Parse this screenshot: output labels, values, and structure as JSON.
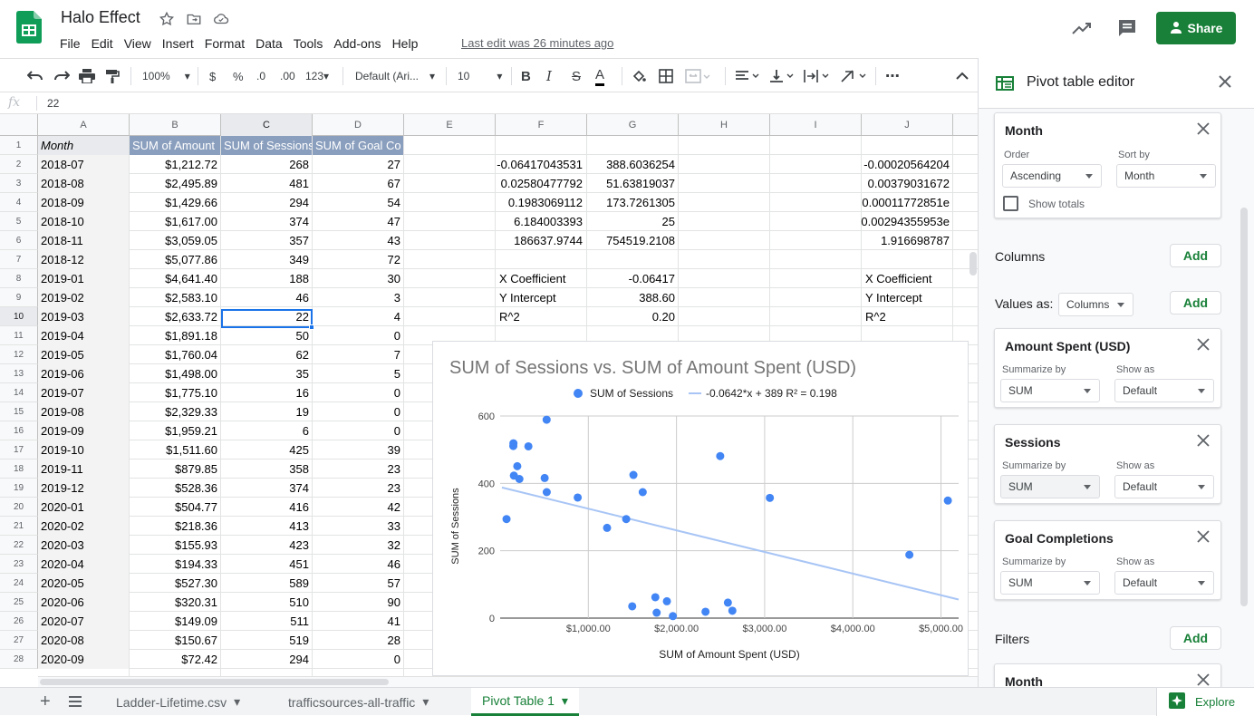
{
  "app": {
    "doc_title": "Halo Effect",
    "menu": [
      "File",
      "Edit",
      "View",
      "Insert",
      "Format",
      "Data",
      "Tools",
      "Add-ons",
      "Help"
    ],
    "last_edit": "Last edit was 26 minutes ago",
    "share_label": "Share",
    "brand_color": "#188038"
  },
  "toolbar": {
    "zoom": "100%",
    "currency": "$",
    "percent": "%",
    "dec_less": ".0",
    "dec_more": ".00",
    "format_more": "123",
    "font": "Default (Ari...",
    "font_size": "10",
    "bold": "B",
    "italic": "I",
    "strike": "S",
    "text_color": "A"
  },
  "formula_bar": {
    "fx": "fx",
    "value": "22"
  },
  "columns": [
    "A",
    "B",
    "C",
    "D",
    "E",
    "F",
    "G",
    "H",
    "I",
    "J"
  ],
  "selected_column": "C",
  "selected_row": 10,
  "header_row": [
    "Month",
    "SUM of Amount",
    "SUM of Sessions",
    "SUM of Goal Co"
  ],
  "rows": [
    [
      "2018-07",
      "$1,212.72",
      "268",
      "27"
    ],
    [
      "2018-08",
      "$2,495.89",
      "481",
      "67"
    ],
    [
      "2018-09",
      "$1,429.66",
      "294",
      "54"
    ],
    [
      "2018-10",
      "$1,617.00",
      "374",
      "47"
    ],
    [
      "2018-11",
      "$3,059.05",
      "357",
      "43"
    ],
    [
      "2018-12",
      "$5,077.86",
      "349",
      "72"
    ],
    [
      "2019-01",
      "$4,641.40",
      "188",
      "30"
    ],
    [
      "2019-02",
      "$2,583.10",
      "46",
      "3"
    ],
    [
      "2019-03",
      "$2,633.72",
      "22",
      "4"
    ],
    [
      "2019-04",
      "$1,891.18",
      "50",
      "0"
    ],
    [
      "2019-05",
      "$1,760.04",
      "62",
      "7"
    ],
    [
      "2019-06",
      "$1,498.00",
      "35",
      "5"
    ],
    [
      "2019-07",
      "$1,775.10",
      "16",
      "0"
    ],
    [
      "2019-08",
      "$2,329.33",
      "19",
      "0"
    ],
    [
      "2019-09",
      "$1,959.21",
      "6",
      "0"
    ],
    [
      "2019-10",
      "$1,511.60",
      "425",
      "39"
    ],
    [
      "2019-11",
      "$879.85",
      "358",
      "23"
    ],
    [
      "2019-12",
      "$528.36",
      "374",
      "23"
    ],
    [
      "2020-01",
      "$504.77",
      "416",
      "42"
    ],
    [
      "2020-02",
      "$218.36",
      "413",
      "33"
    ],
    [
      "2020-03",
      "$155.93",
      "423",
      "32"
    ],
    [
      "2020-04",
      "$194.33",
      "451",
      "46"
    ],
    [
      "2020-05",
      "$527.30",
      "589",
      "57"
    ],
    [
      "2020-06",
      "$320.31",
      "510",
      "90"
    ],
    [
      "2020-07",
      "$149.09",
      "511",
      "41"
    ],
    [
      "2020-08",
      "$150.67",
      "519",
      "28"
    ],
    [
      "2020-09",
      "$72.42",
      "294",
      "0"
    ]
  ],
  "regression_fg": [
    [
      "-0.06417043531",
      "388.6036254"
    ],
    [
      "0.02580477792",
      "51.63819037"
    ],
    [
      "0.1983069112",
      "173.7261305"
    ],
    [
      "6.184003393",
      "25"
    ],
    [
      "186637.9744",
      "754519.2108"
    ],
    [
      "",
      ""
    ],
    [
      "X Coefficient",
      "-0.06417"
    ],
    [
      "Y Intercept",
      "388.60"
    ],
    [
      "R^2",
      "0.20"
    ]
  ],
  "regression_j": [
    "-0.00020564204",
    "0.00379031672",
    "0.00011772851е",
    "0.00294355953е",
    "1.916698787",
    "",
    "X Coefficient",
    "Y Intercept",
    "R^2"
  ],
  "chart_data": {
    "type": "scatter",
    "title": "SUM of Sessions vs. SUM of Amount Spent (USD)",
    "xlabel": "SUM of Amount Spent (USD)",
    "ylabel": "SUM of Sessions",
    "xlim": [
      0,
      5200
    ],
    "ylim": [
      0,
      600
    ],
    "x_ticks": [
      "$1,000.00",
      "$2,000.00",
      "$3,000.00",
      "$4,000.00",
      "$5,000.00"
    ],
    "x_tick_values": [
      1000,
      2000,
      3000,
      4000,
      5000
    ],
    "y_ticks": [
      "0",
      "200",
      "400",
      "600"
    ],
    "y_tick_values": [
      0,
      200,
      400,
      600
    ],
    "legend": [
      "SUM of Sessions",
      "-0.0642*x + 389 R² = 0.198"
    ],
    "legend_position": "top",
    "series_color": "#4285f4",
    "trend_color": "#a8c5f5",
    "trendline": {
      "slope": -0.0642,
      "intercept": 389,
      "r2": 0.198
    },
    "points": [
      [
        1212.72,
        268
      ],
      [
        2495.89,
        481
      ],
      [
        1429.66,
        294
      ],
      [
        1617.0,
        374
      ],
      [
        3059.05,
        357
      ],
      [
        5077.86,
        349
      ],
      [
        4641.4,
        188
      ],
      [
        2583.1,
        46
      ],
      [
        2633.72,
        22
      ],
      [
        1891.18,
        50
      ],
      [
        1760.04,
        62
      ],
      [
        1498.0,
        35
      ],
      [
        1775.1,
        16
      ],
      [
        2329.33,
        19
      ],
      [
        1959.21,
        6
      ],
      [
        1511.6,
        425
      ],
      [
        879.85,
        358
      ],
      [
        528.36,
        374
      ],
      [
        504.77,
        416
      ],
      [
        218.36,
        413
      ],
      [
        155.93,
        423
      ],
      [
        194.33,
        451
      ],
      [
        527.3,
        589
      ],
      [
        320.31,
        510
      ],
      [
        149.09,
        511
      ],
      [
        150.67,
        519
      ],
      [
        72.42,
        294
      ]
    ]
  },
  "sheet_tabs": [
    {
      "label": "Ladder-Lifetime.csv",
      "active": false
    },
    {
      "label": "trafficsources-all-traffic",
      "active": false
    },
    {
      "label": "Pivot Table 1",
      "active": true
    }
  ],
  "explore_label": "Explore",
  "panel": {
    "title": "Pivot table editor",
    "rows_card": {
      "title": "Month",
      "order_label": "Order",
      "order_value": "Ascending",
      "sort_label": "Sort by",
      "sort_value": "Month",
      "show_totals": "Show totals"
    },
    "columns_label": "Columns",
    "values_as_label": "Values as:",
    "values_as_value": "Columns",
    "add_label": "Add",
    "value_cards": [
      {
        "title": "Amount Spent (USD)",
        "summarize_label": "Summarize by",
        "summarize_value": "SUM",
        "show_as_label": "Show as",
        "show_as_value": "Default"
      },
      {
        "title": "Sessions",
        "summarize_label": "Summarize by",
        "summarize_value": "SUM",
        "show_as_label": "Show as",
        "show_as_value": "Default"
      },
      {
        "title": "Goal Completions",
        "summarize_label": "Summarize by",
        "summarize_value": "SUM",
        "show_as_label": "Show as",
        "show_as_value": "Default"
      }
    ],
    "filters_label": "Filters",
    "filter_card_title": "Month"
  }
}
